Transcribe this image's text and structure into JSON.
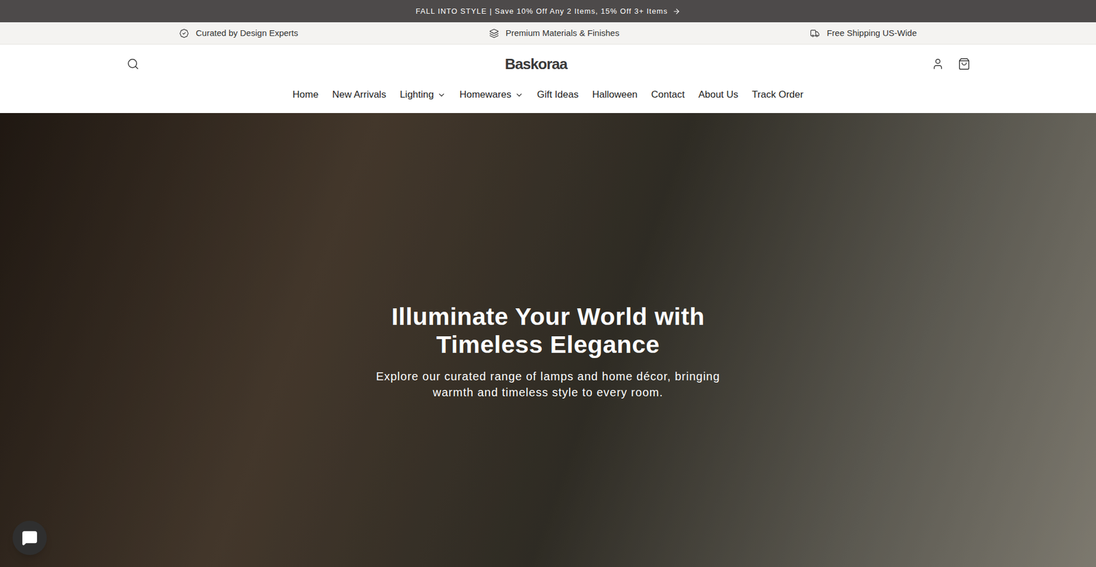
{
  "announcement": {
    "text": "FALL INTO STYLE | Save 10% Off Any 2 Items, 15% Off 3+ Items"
  },
  "features": [
    {
      "label": "Curated by Design Experts",
      "kind": "badge"
    },
    {
      "label": "Premium Materials & Finishes",
      "kind": "layers"
    },
    {
      "label": "Free Shipping US-Wide",
      "kind": "truck"
    }
  ],
  "header": {
    "logo": "Baskoraa"
  },
  "nav": [
    {
      "label": "Home",
      "dropdown": false
    },
    {
      "label": "New Arrivals",
      "dropdown": false
    },
    {
      "label": "Lighting",
      "dropdown": true
    },
    {
      "label": "Homewares",
      "dropdown": true
    },
    {
      "label": "Gift Ideas",
      "dropdown": false
    },
    {
      "label": "Halloween",
      "dropdown": false
    },
    {
      "label": "Contact",
      "dropdown": false
    },
    {
      "label": "About Us",
      "dropdown": false
    },
    {
      "label": "Track Order",
      "dropdown": false
    }
  ],
  "hero": {
    "title": "Illuminate Your World with Timeless Elegance",
    "subtitle": "Explore our curated range of lamps and home décor, bringing warmth and timeless style to every room."
  }
}
